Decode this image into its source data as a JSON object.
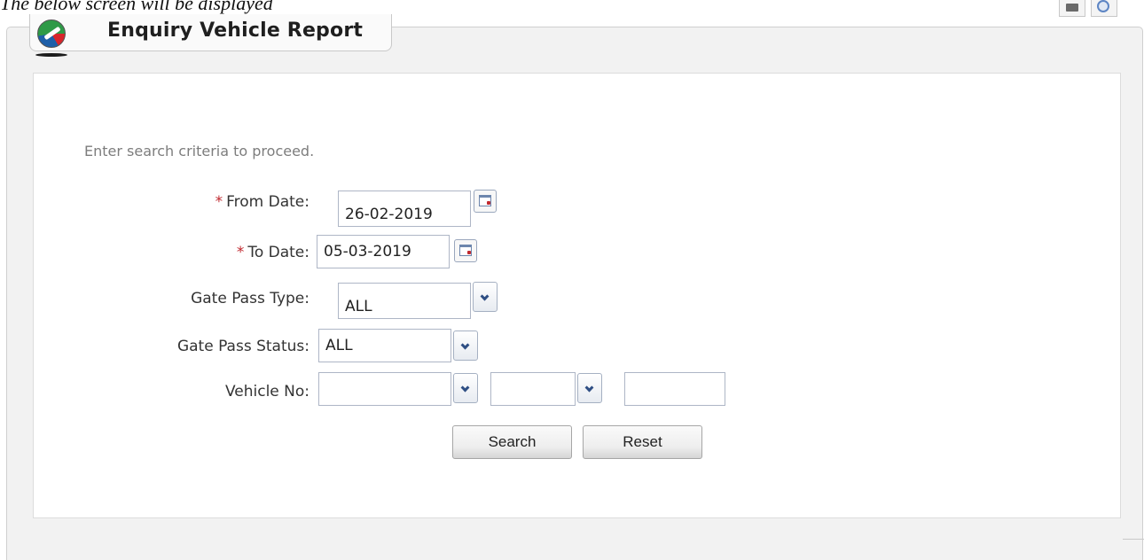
{
  "caption": "The below screen will be displayed",
  "page": {
    "title": "Enquiry Vehicle Report"
  },
  "form": {
    "hint": "Enter search criteria to proceed.",
    "required_marker": "*",
    "from_date": {
      "label": "From Date:",
      "value": "26-02-2019"
    },
    "to_date": {
      "label": "To Date:",
      "value": "05-03-2019"
    },
    "gate_pass_type": {
      "label": "Gate Pass Type:",
      "value": "ALL"
    },
    "gate_pass_status": {
      "label": "Gate Pass Status:",
      "value": "ALL"
    },
    "vehicle_no": {
      "label": "Vehicle No:",
      "select1_value": "",
      "select2_value": "",
      "text_value": ""
    },
    "search_label": "Search",
    "reset_label": "Reset"
  },
  "icons": {
    "logo": "app-logo-icon",
    "print": "printer-icon",
    "help": "help-icon",
    "calendar": "calendar-icon",
    "dropdown": "chevron-down-icon"
  },
  "colors": {
    "required": "#c0292f",
    "panel_bg": "#f2f2f2",
    "form_bg": "#ffffff",
    "hint_text": "#7d7d7d"
  }
}
